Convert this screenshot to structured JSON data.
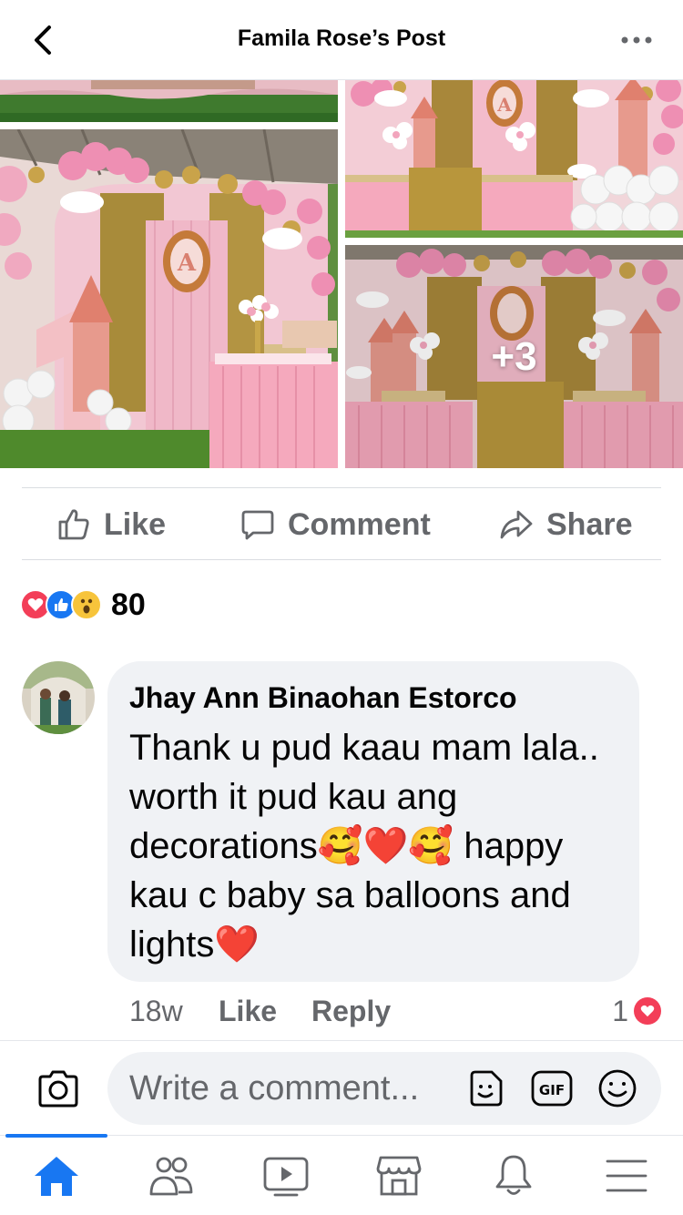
{
  "header": {
    "title": "Famila Rose’s Post",
    "back_icon": "chevron-left-icon",
    "more_icon": "more-dots-icon"
  },
  "photos": {
    "more_count": "+3"
  },
  "actions": {
    "like": "Like",
    "comment": "Comment",
    "share": "Share"
  },
  "reactions": {
    "types": [
      "love",
      "like",
      "wow"
    ],
    "count": "80"
  },
  "comment": {
    "author": "Jhay Ann Binaohan Estorco",
    "text": "Thank u pud kaau mam lala.. worth it pud kau ang decorations🥰❤️🥰 happy kau c baby sa balloons and lights❤️",
    "time": "18w",
    "like_label": "Like",
    "reply_label": "Reply",
    "reaction_count": "1"
  },
  "composer": {
    "placeholder": "Write a comment..."
  },
  "bottom_nav": {
    "items": [
      "home-icon",
      "friends-icon",
      "watch-icon",
      "marketplace-icon",
      "notifications-icon",
      "menu-icon"
    ],
    "active": "home-icon"
  },
  "colors": {
    "brand_blue": "#1877f2",
    "love_red": "#f33e58",
    "muted_text": "#65676b",
    "bubble_bg": "#f0f2f5"
  }
}
